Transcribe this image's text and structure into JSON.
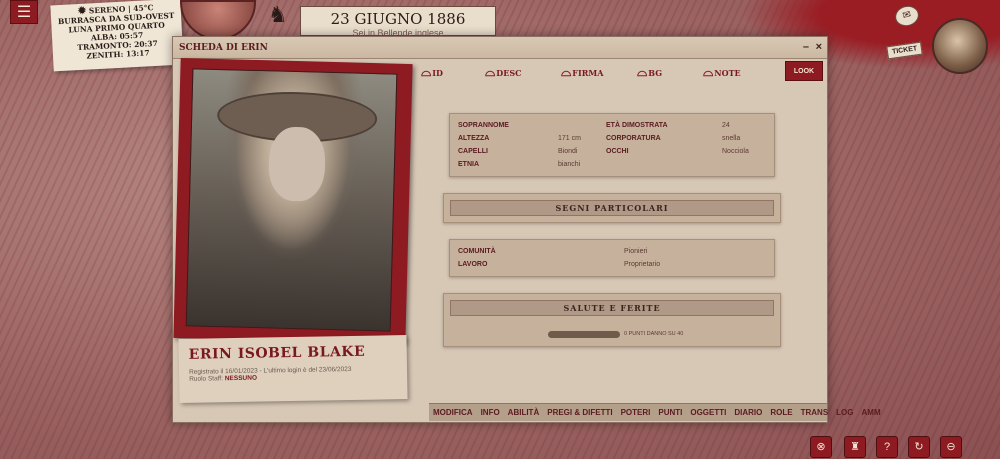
{
  "topbar": {
    "menu_icon": "☰",
    "weather": {
      "condition": "SERENO | 45°C",
      "wind": "BURRASCA DA SUD-OVEST",
      "moon": "LUNA PRIMO QUARTO",
      "dawn": "ALBA: 05:57",
      "sunset": "TRAMONTO: 20:37",
      "zenith": "ZENITH: 13:17"
    },
    "date": "23 GIUGNO 1886",
    "date_sub": "Sei in Bellende inglese",
    "ticket_label": "TICKET"
  },
  "panel": {
    "title": "SCHEDA DI ERIN",
    "minimize": "–",
    "close": "×",
    "look_button": "LOOK",
    "tabs": [
      "ID",
      "DESC",
      "FIRMA",
      "BG",
      "NOTE"
    ],
    "character": {
      "name": "ERIN ISOBEL BLAKE",
      "registered": "Registrato il 16/01/2023 - L'ultimo login è del 23/06/2023",
      "staff_label": "Ruolo Staff:",
      "staff_value": "NESSUNO"
    },
    "stats": {
      "soprannome_label": "SOPRANNOME",
      "soprannome_value": "",
      "eta_label": "ETÀ DIMOSTRATA",
      "eta_value": "24",
      "altezza_label": "ALTEZZA",
      "altezza_value": "171 cm",
      "corporatura_label": "CORPORATURA",
      "corporatura_value": "snella",
      "capelli_label": "CAPELLI",
      "capelli_value": "Biondi",
      "occhi_label": "OCCHI",
      "occhi_value": "Nocciola",
      "etnia_label": "ETNIA",
      "etnia_value": "bianchi"
    },
    "segni_title": "SEGNI PARTICOLARI",
    "community": {
      "comunita_label": "COMUNITÀ",
      "comunita_value": "Pionieri",
      "lavoro_label": "LAVORO",
      "lavoro_value": "Proprietario"
    },
    "health": {
      "title": "SALUTE E FERITE",
      "text": "0 PUNTI DANNO SU 40",
      "damage": 0,
      "max": 40
    },
    "bottom_nav": [
      "MODIFICA",
      "INFO",
      "ABILITÀ",
      "PREGI & DIFETTI",
      "POTERI",
      "PUNTI",
      "OGGETTI",
      "DIARIO",
      "ROLE",
      "TRANS",
      "LOG",
      "AMM"
    ]
  },
  "corner_icons": [
    "close-circle-icon",
    "hat-icon",
    "help-icon",
    "refresh-icon",
    "no-entry-icon"
  ]
}
